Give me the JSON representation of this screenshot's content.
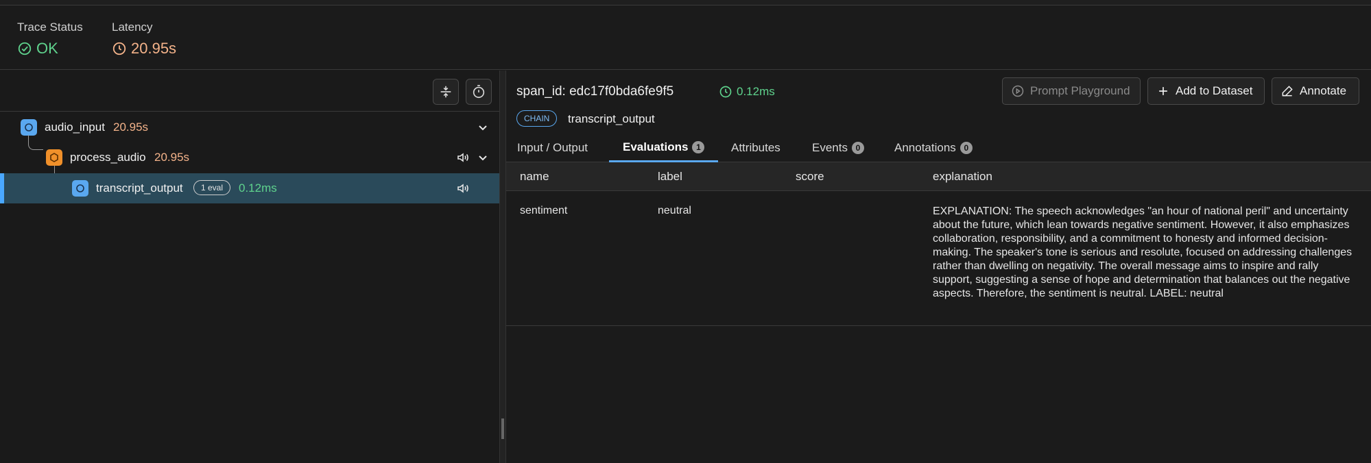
{
  "trace": {
    "status_label": "Trace Status",
    "status_value": "OK",
    "latency_label": "Latency",
    "latency_value": "20.95s"
  },
  "tree": {
    "nodes": [
      {
        "name": "audio_input",
        "duration": "20.95s",
        "kind_color": "#5aa8f0"
      },
      {
        "name": "process_audio",
        "duration": "20.95s",
        "kind_color": "#f0902a"
      },
      {
        "name": "transcript_output",
        "duration": "0.12ms",
        "eval_badge": "1 eval",
        "kind_color": "#5aa8f0"
      }
    ]
  },
  "span": {
    "id_text": "span_id: edc17f0bda6fe9f5",
    "latency": "0.12ms",
    "kind": "CHAIN",
    "name": "transcript_output",
    "buttons": {
      "playground": "Prompt Playground",
      "add_dataset": "Add to Dataset",
      "annotate": "Annotate"
    }
  },
  "tabs": [
    {
      "label": "Input / Output"
    },
    {
      "label": "Evaluations",
      "count": "1"
    },
    {
      "label": "Attributes"
    },
    {
      "label": "Events",
      "count": "0"
    },
    {
      "label": "Annotations",
      "count": "0"
    }
  ],
  "evaluations": {
    "columns": [
      "name",
      "label",
      "score",
      "explanation"
    ],
    "rows": [
      {
        "name": "sentiment",
        "label": "neutral",
        "score": "",
        "explanation": "EXPLANATION: The speech acknowledges \"an hour of national peril\" and uncertainty about the future, which lean towards negative sentiment. However, it also emphasizes collaboration, responsibility, and a commitment to honesty and informed decision-making. The speaker's tone is serious and resolute, focused on addressing challenges rather than dwelling on negativity. The overall message aims to inspire and rally support, suggesting a sense of hope and determination that balances out the negative aspects. Therefore, the sentiment is neutral. LABEL: neutral"
      }
    ]
  },
  "colors": {
    "accent": "#5aa8f0",
    "ok": "#5fd38d",
    "latency": "#f4b38a",
    "selected_row": "#2a4a5a"
  }
}
